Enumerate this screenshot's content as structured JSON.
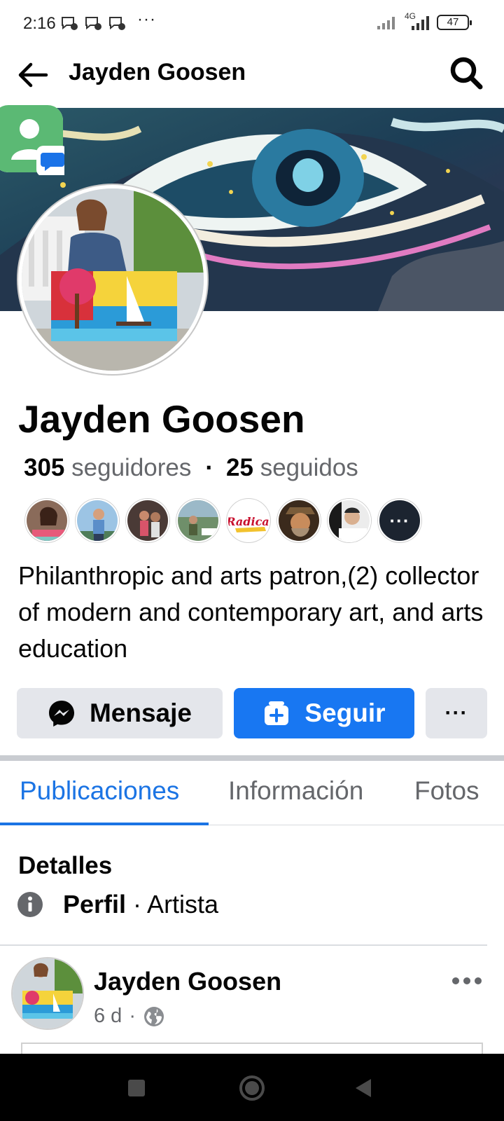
{
  "status_bar": {
    "time": "2:16",
    "more": "···",
    "network": "4G",
    "battery": "47"
  },
  "header": {
    "title": "Jayden Goosen"
  },
  "profile": {
    "name": "Jayden Goosen",
    "followers_count": "305",
    "followers_label": "seguidores",
    "separator": "·",
    "following_count": "25",
    "following_label": "seguidos",
    "bio": "Philanthropic and arts patron,(2) collector of modern and contemporary art, and arts education",
    "more_followers": "···"
  },
  "actions": {
    "message_label": "Mensaje",
    "follow_label": "Seguir",
    "more_label": "···"
  },
  "tabs": [
    {
      "label": "Publicaciones",
      "active": true
    },
    {
      "label": "Información",
      "active": false
    },
    {
      "label": "Fotos",
      "active": false
    }
  ],
  "details": {
    "title": "Detalles",
    "profile_label": "Perfil",
    "profile_type": "· Artista"
  },
  "post": {
    "author": "Jayden Goosen",
    "time": "6 d",
    "separator": "·"
  },
  "colors": {
    "accent": "#1877f2",
    "tab_active": "#1b74e4",
    "secondary_button": "#e4e6eb",
    "muted_text": "#65676b"
  }
}
